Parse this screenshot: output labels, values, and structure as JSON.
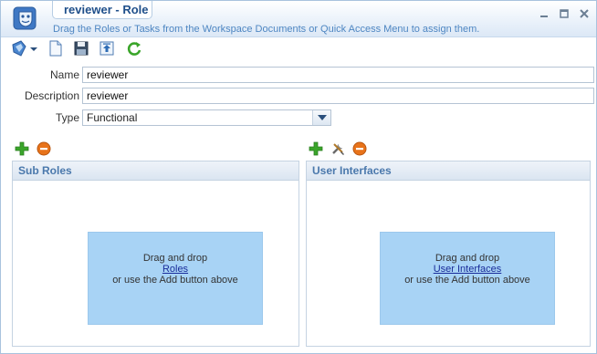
{
  "header": {
    "title": "reviewer - Role",
    "hint": "Drag the Roles or Tasks from the Workspace Documents or Quick Access Menu to assign them."
  },
  "window_controls": {
    "icons": [
      "minimize-icon",
      "restore-icon",
      "close-icon"
    ]
  },
  "toolbar": {
    "icons": [
      "app-menu-icon",
      "dropdown-arrow-icon",
      "new-document-icon",
      "save-icon",
      "export-icon",
      "refresh-icon"
    ]
  },
  "form": {
    "name_label": "Name",
    "name_value": "reviewer",
    "description_label": "Description",
    "description_value": "reviewer",
    "type_label": "Type",
    "type_value": "Functional"
  },
  "sub_roles": {
    "title": "Sub Roles",
    "drop_line1": "Drag and drop",
    "drop_link": "Roles",
    "drop_line3": "or use the Add button above"
  },
  "user_interfaces": {
    "title": "User Interfaces",
    "drop_line1": "Drag and drop",
    "drop_link": "User Interfaces",
    "drop_line3": "or use the Add button above"
  },
  "colors": {
    "accent": "#1f4f8a",
    "hint": "#4e86c2",
    "panel_title": "#4a78ac",
    "drop_zone": "#a8d3f5",
    "add_green": "#3aa52a",
    "remove_orange": "#e8731a"
  }
}
